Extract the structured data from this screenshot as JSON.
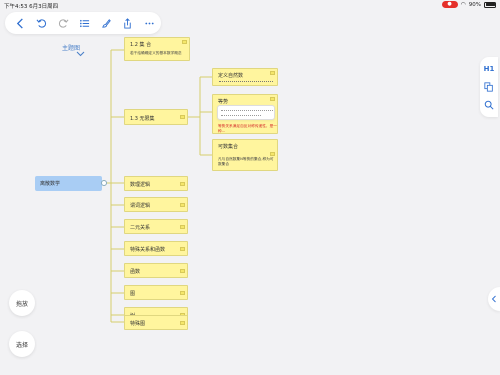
{
  "status": {
    "time": "下午4:53",
    "date": "6月3日周四",
    "battery": "90%"
  },
  "toolbar": {
    "back_icon": "chevron-left-icon",
    "undo_icon": "undo-icon",
    "redo_icon": "redo-icon",
    "outline_icon": "list-icon",
    "style_icon": "brush-icon",
    "share_icon": "share-icon",
    "more_icon": "ellipsis-icon"
  },
  "canvas": {
    "root_title": "主题图",
    "central_topic": "离散数学",
    "nodes": [
      {
        "title": "1.2 集 合",
        "desc": "若干给确确定义的基本数学概念"
      },
      {
        "title": "1.3 无限集"
      },
      {
        "title": "数理逻辑"
      },
      {
        "title": "谓词逻辑"
      },
      {
        "title": "二元关系"
      },
      {
        "title": "特殊关系和函数"
      },
      {
        "title": "函数"
      },
      {
        "title": "图"
      },
      {
        "title": "树"
      },
      {
        "title": "特殊图"
      }
    ],
    "sub_nodes": [
      {
        "title": "定义自然数"
      },
      {
        "title": "等势",
        "red_note": "等势关系满足自反对称传递性，是一种..."
      },
      {
        "title": "可数集合",
        "desc": "凡与自然数集N等势的集合,称为可数集合"
      }
    ]
  },
  "side_panel": {
    "heading_label": "H1"
  },
  "bottom_left": {
    "relayout_label": "拖放",
    "select_label": "选择"
  },
  "colors": {
    "node_fill": "#fff59e",
    "central_fill": "#a9cdf4",
    "line": "#d6cf6b",
    "accent": "#2f6fd0"
  }
}
